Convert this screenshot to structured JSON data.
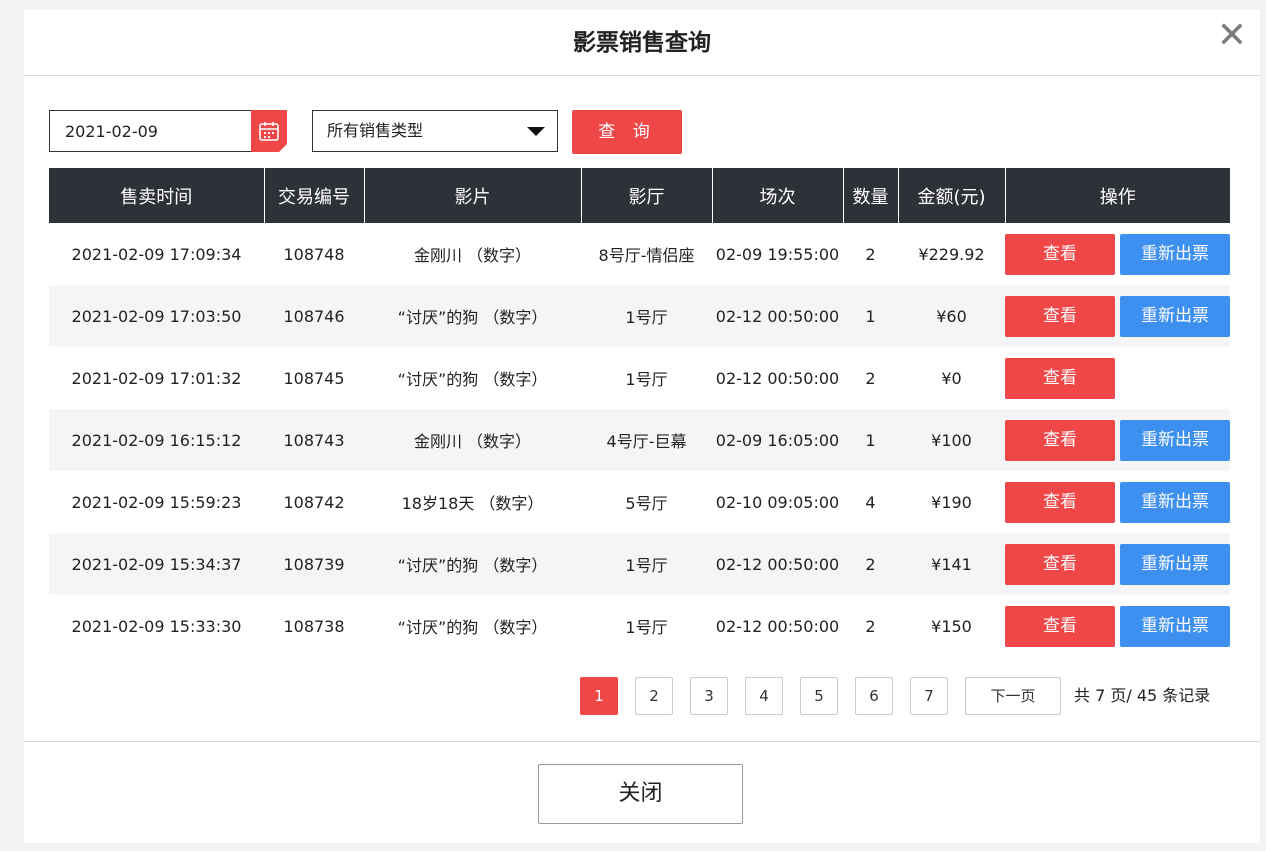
{
  "dialog": {
    "title": "影票销售查询",
    "close_icon": "close-icon",
    "close_glyph": "✕"
  },
  "filters": {
    "date": "2021-02-09",
    "calendar_icon": "calendar-icon",
    "sale_type": "所有销售类型",
    "query_label": "查 询"
  },
  "table": {
    "headers": [
      "售卖时间",
      "交易编号",
      "影片",
      "影厅",
      "场次",
      "数量",
      "金额(元)",
      "操作"
    ],
    "view_label": "查看",
    "reissue_label": "重新出票",
    "rows": [
      {
        "time": "2021-02-09 17:09:34",
        "id": "108748",
        "film": "金刚川 （数字）",
        "hall": "8号厅-情侣座",
        "session": "02-09 19:55:00",
        "qty": "2",
        "amount": "¥229.92",
        "reissue": true
      },
      {
        "time": "2021-02-09 17:03:50",
        "id": "108746",
        "film": "“讨厌”的狗 （数字）",
        "hall": "1号厅",
        "session": "02-12 00:50:00",
        "qty": "1",
        "amount": "¥60",
        "reissue": true
      },
      {
        "time": "2021-02-09 17:01:32",
        "id": "108745",
        "film": "“讨厌”的狗 （数字）",
        "hall": "1号厅",
        "session": "02-12 00:50:00",
        "qty": "2",
        "amount": "¥0",
        "reissue": false
      },
      {
        "time": "2021-02-09 16:15:12",
        "id": "108743",
        "film": "金刚川 （数字）",
        "hall": "4号厅-巨幕",
        "session": "02-09 16:05:00",
        "qty": "1",
        "amount": "¥100",
        "reissue": true
      },
      {
        "time": "2021-02-09 15:59:23",
        "id": "108742",
        "film": "18岁18天 （数字）",
        "hall": "5号厅",
        "session": "02-10 09:05:00",
        "qty": "4",
        "amount": "¥190",
        "reissue": true
      },
      {
        "time": "2021-02-09 15:34:37",
        "id": "108739",
        "film": "“讨厌”的狗 （数字）",
        "hall": "1号厅",
        "session": "02-12 00:50:00",
        "qty": "2",
        "amount": "¥141",
        "reissue": true
      },
      {
        "time": "2021-02-09 15:33:30",
        "id": "108738",
        "film": "“讨厌”的狗 （数字）",
        "hall": "1号厅",
        "session": "02-12 00:50:00",
        "qty": "2",
        "amount": "¥150",
        "reissue": true
      }
    ]
  },
  "pagination": {
    "pages": [
      "1",
      "2",
      "3",
      "4",
      "5",
      "6",
      "7"
    ],
    "current": "1",
    "next_label": "下一页",
    "summary": "共 7 页/ 45 条记录"
  },
  "footer": {
    "close_label": "关闭"
  },
  "colors": {
    "accent_red": "#ef4747",
    "accent_blue": "#3d8ff0",
    "header_dark": "#2e3138"
  }
}
